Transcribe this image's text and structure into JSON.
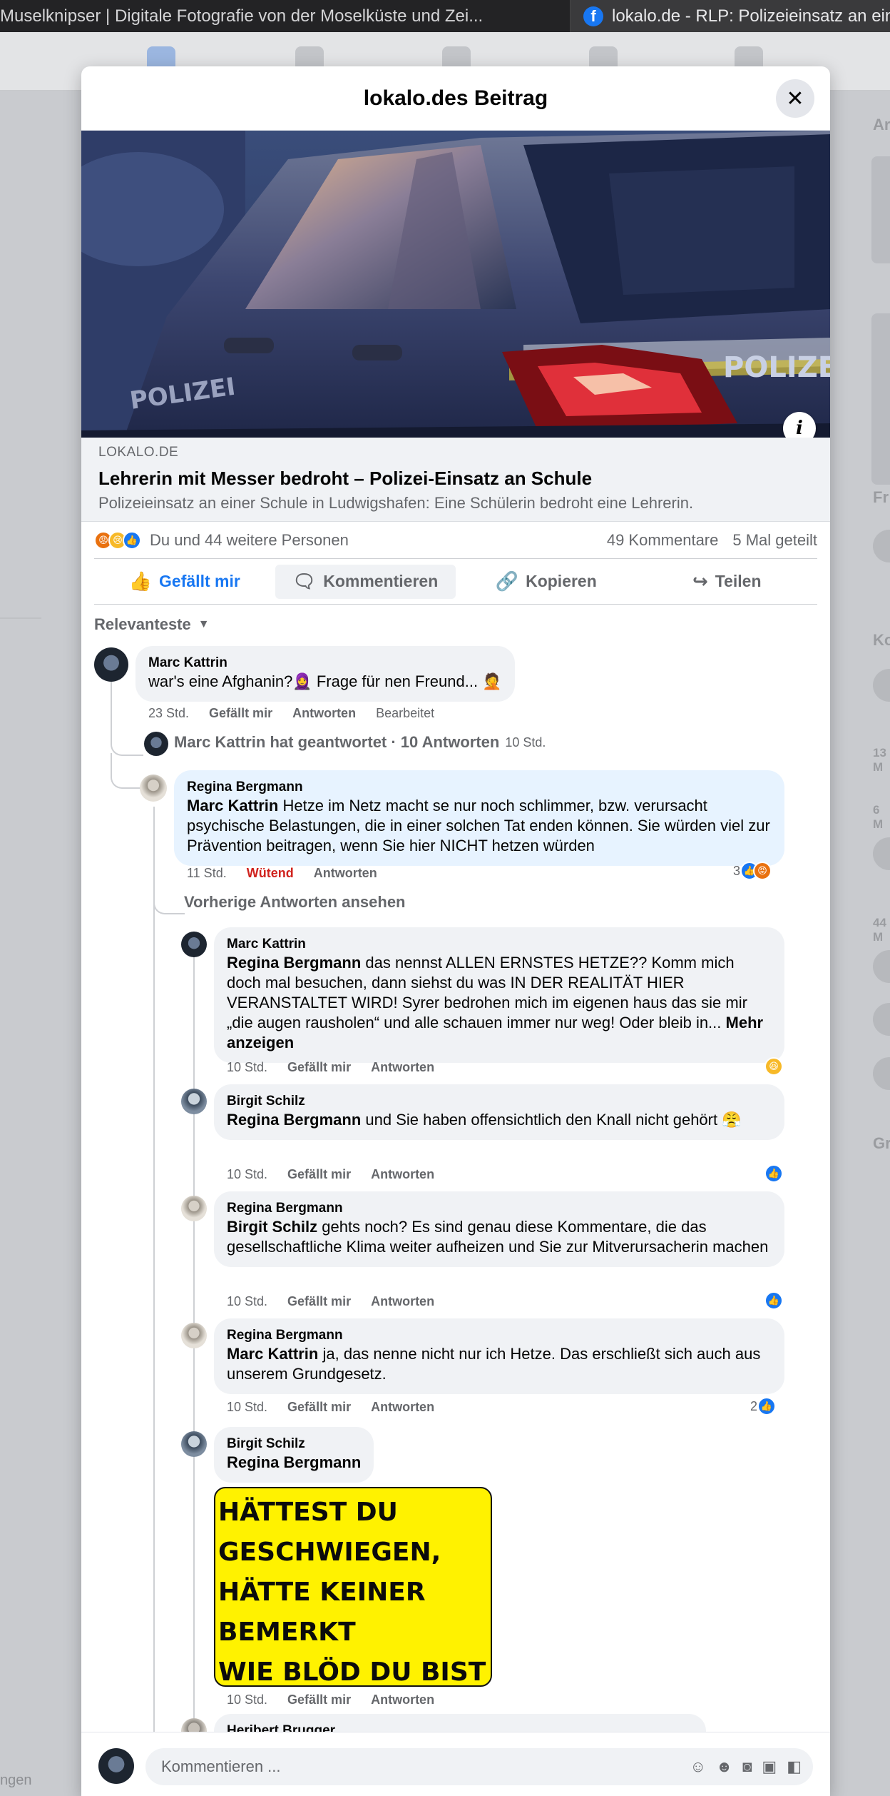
{
  "browser": {
    "tab_inactive": "Muselknipser | Digitale Fotografie von der Moselküste und Zei...",
    "tab_active": "lokalo.de - RLP: Polizeieinsatz an eine"
  },
  "background": {
    "right_labels": [
      "Ar",
      "Fr",
      "Ko",
      "13 M",
      "6 M",
      "44 M",
      "Gr"
    ],
    "left_footer": "ngen"
  },
  "modal": {
    "title": "lokalo.des Beitrag",
    "hero_image_text": "POLIZEI"
  },
  "link_preview": {
    "domain": "LOKALO.DE",
    "title": "Lehrerin mit Messer bedroht – Polizei-Einsatz an Schule",
    "description": "Polizeieinsatz an einer Schule in Ludwigshafen: Eine Schülerin bedroht eine Lehrerin."
  },
  "stats": {
    "reactions_text": "Du und 44 weitere Personen",
    "comments": "49 Kommentare",
    "shares": "5 Mal geteilt"
  },
  "actions": {
    "like": "Gefällt mir",
    "comment": "Kommentieren",
    "copy": "Kopieren",
    "share": "Teilen"
  },
  "sort_label": "Relevanteste",
  "comments": [
    {
      "author": "Marc Kattrin",
      "text": "war's eine Afghanin?🧕 Frage für nen Freund... 🤦",
      "time": "23 Std.",
      "like": "Gefällt mir",
      "reply": "Antworten",
      "edited": "Bearbeitet"
    }
  ],
  "replies_summary": {
    "text": "Marc Kattrin hat geantwortet · 10 Antworten",
    "time": "10 Std."
  },
  "reply_main": {
    "author": "Regina Bergmann",
    "tag": "Marc Kattrin",
    "text": " Hetze im Netz macht se nur noch schlimmer, bzw. verursacht psychische Belastungen, die in einer solchen Tat enden können. Sie würden viel zur Prävention beitragen, wenn Sie hier NICHT hetzen würden",
    "time": "11 Std.",
    "reaction_label": "Wütend",
    "reply": "Antworten",
    "reaction_count": "3"
  },
  "previous_replies": "Vorherige Antworten ansehen",
  "replies": [
    {
      "author": "Marc Kattrin",
      "tag": "Regina Bergmann",
      "text": " das nennst ALLEN ERNSTES HETZE?? Komm mich doch mal besuchen, dann siehst du was IN DER REALITÄT HIER VERANSTALTET WIRD! Syrer bedrohen mich im eigenen haus das sie mir „die augen rausholen“ und alle schauen immer nur weg! Oder bleib in...",
      "more": "Mehr anzeigen",
      "time": "10 Std.",
      "like": "Gefällt mir",
      "reply": "Antworten"
    },
    {
      "author": "Birgit Schilz",
      "tag": "Regina Bergmann",
      "text": " und Sie haben offensichtlich den Knall nicht gehört 😤",
      "time": "10 Std.",
      "like": "Gefällt mir",
      "reply": "Antworten"
    },
    {
      "author": "Regina Bergmann",
      "tag": "Birgit Schilz",
      "text": " gehts noch? Es sind genau diese Kommentare, die das gesellschaftliche Klima weiter aufheizen und Sie zur Mitverursacherin machen",
      "time": "10 Std.",
      "like": "Gefällt mir",
      "reply": "Antworten"
    },
    {
      "author": "Regina Bergmann",
      "tag": "Marc Kattrin",
      "text": " ja, das nenne nicht nur ich Hetze. Das erschließt sich auch aus unserem Grundgesetz.",
      "time": "10 Std.",
      "like": "Gefällt mir",
      "reply": "Antworten",
      "reaction_count": "2"
    },
    {
      "author": "Birgit Schilz",
      "tag": "Regina Bergmann",
      "meme_lines": [
        "HÄTTEST DU",
        "GESCHWIEGEN,",
        " HÄTTE KEINER",
        "BEMERKT",
        " WIE BLÖD DU BIST"
      ],
      "time": "10 Std.",
      "like": "Gefällt mir",
      "reply": "Antworten"
    },
    {
      "author": "Heribert Brugger"
    }
  ],
  "composer": {
    "placeholder": "Kommentieren ..."
  },
  "colors": {
    "accent": "#1877f2",
    "angry": "#d0231e"
  }
}
